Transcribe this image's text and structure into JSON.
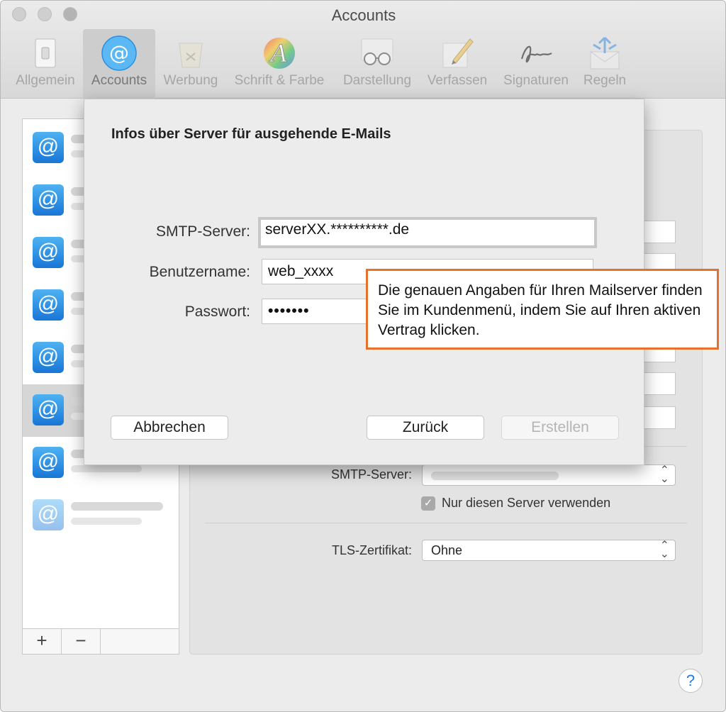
{
  "window": {
    "title": "Accounts"
  },
  "toolbar": {
    "items": [
      {
        "label": "Allgemein",
        "icon": "switch-icon"
      },
      {
        "label": "Accounts",
        "icon": "at-icon"
      },
      {
        "label": "Werbung",
        "icon": "junk-bin-icon"
      },
      {
        "label": "Schrift & Farbe",
        "icon": "font-color-icon"
      },
      {
        "label": "Darstellung",
        "icon": "glasses-icon"
      },
      {
        "label": "Verfassen",
        "icon": "pencil-icon"
      },
      {
        "label": "Signaturen",
        "icon": "signature-icon"
      },
      {
        "label": "Regeln",
        "icon": "rules-envelope-icon"
      }
    ],
    "active": "Accounts"
  },
  "sidebar": {
    "account_icon_glyph": "@",
    "selected_index": 5,
    "add_label": "+",
    "remove_label": "−"
  },
  "panel": {
    "smtp_label": "SMTP-Server:",
    "only_this_server_label": "Nur diesen Server verwenden",
    "only_this_server_checked": true,
    "tls_label": "TLS-Zertifikat:",
    "tls_value": "Ohne"
  },
  "sheet": {
    "title": "Infos über Server für ausgehende E-Mails",
    "smtp_server_label": "SMTP-Server:",
    "smtp_server_value": "serverXX.**********.de",
    "username_label": "Benutzername:",
    "username_value": "web_xxxx",
    "password_label": "Passwort:",
    "password_value": "•••••••",
    "cancel_label": "Abbrechen",
    "back_label": "Zurück",
    "create_label": "Erstellen"
  },
  "callout": {
    "text": "Die genauen Angaben für Ihren Mailserver finden Sie im Kundenmenü, indem Sie auf Ihren aktiven Vertrag klicken.",
    "border_color": "#e4722c"
  },
  "help": {
    "label": "?"
  }
}
